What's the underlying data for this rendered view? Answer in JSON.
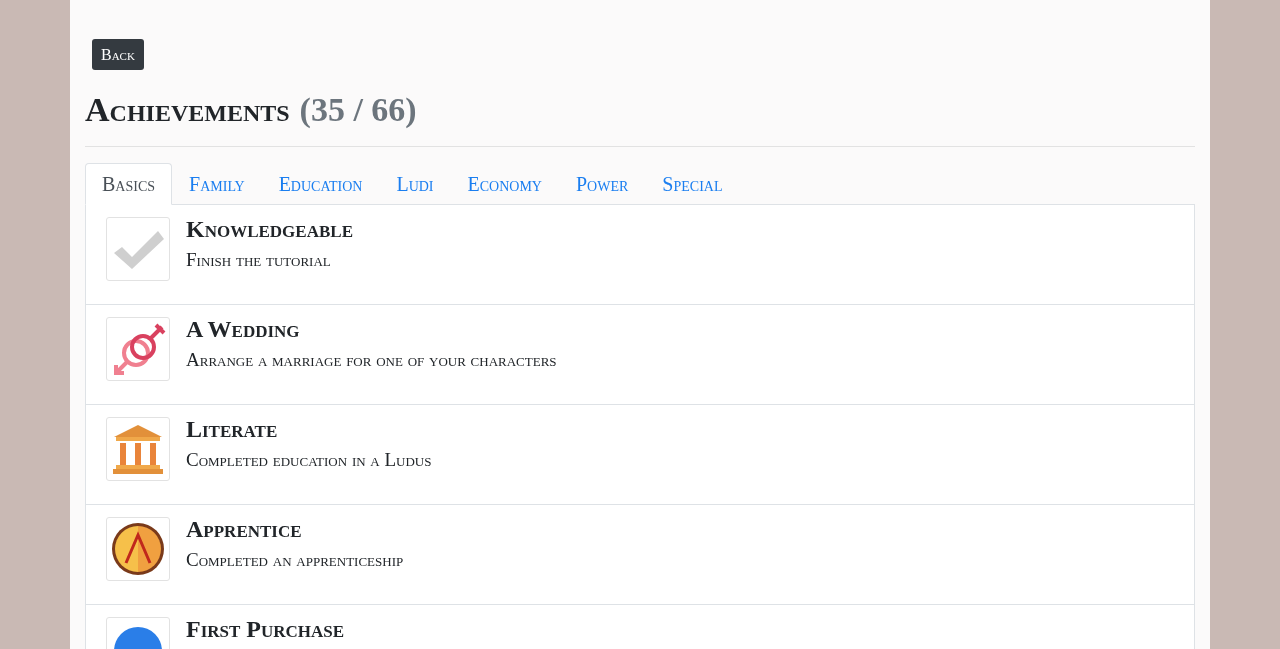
{
  "back_button": "Back",
  "heading": {
    "title": "Achievements",
    "count": "(35 / 66)"
  },
  "tabs": [
    {
      "label": "Basics",
      "selected": true
    },
    {
      "label": "Family",
      "selected": false
    },
    {
      "label": "Education",
      "selected": false
    },
    {
      "label": "Ludi",
      "selected": false
    },
    {
      "label": "Economy",
      "selected": false
    },
    {
      "label": "Power",
      "selected": false
    },
    {
      "label": "Special",
      "selected": false
    }
  ],
  "achievements": [
    {
      "kind": "check",
      "title": "Knowledgeable",
      "description": "Finish the tutorial"
    },
    {
      "kind": "rings",
      "title": "A Wedding",
      "description": "Arrange a marriage for one of your characters"
    },
    {
      "kind": "temple",
      "title": "Literate",
      "description": "Completed education in a Ludus"
    },
    {
      "kind": "shield",
      "title": "Apprentice",
      "description": "Completed an apprenticeship"
    },
    {
      "kind": "globe",
      "title": "First Purchase"
    }
  ]
}
